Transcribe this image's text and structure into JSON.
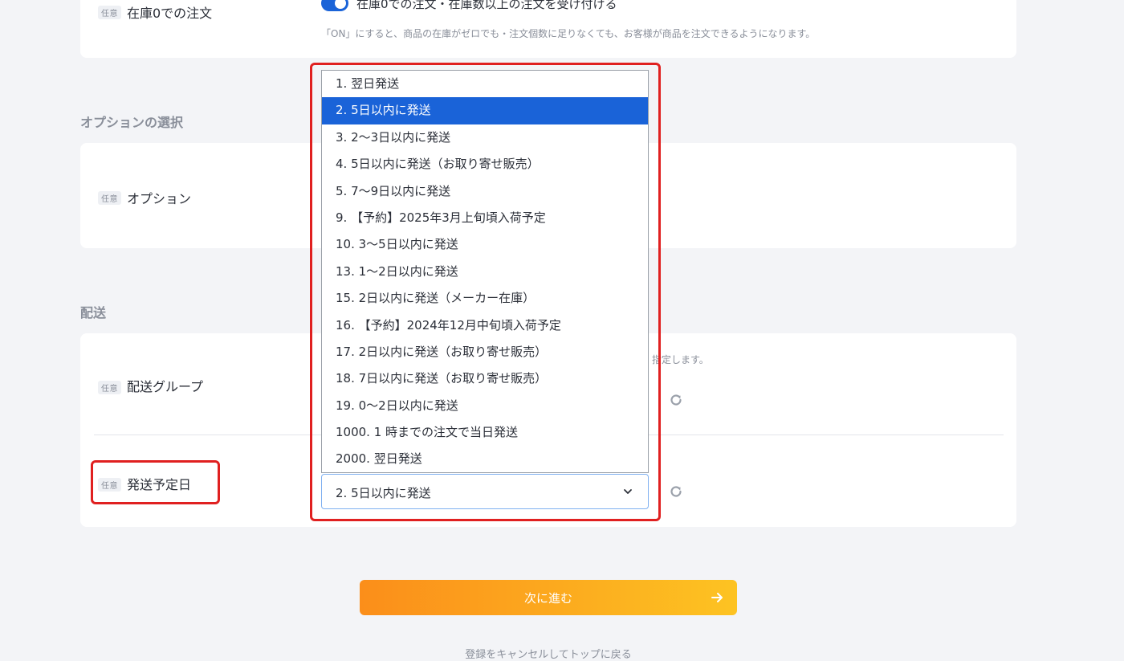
{
  "stock_zero": {
    "badge": "任意",
    "label": "在庫0での注文",
    "toggle_label": "在庫0での注文・在庫数以上の注文を受け付ける",
    "toggle_on": true,
    "helper": "「ON」にすると、商品の在庫がゼロでも・注文個数に足りなくても、お客様が商品を注文できるようになります。"
  },
  "options_section": {
    "title": "オプションの選択",
    "badge": "任意",
    "label": "オプション"
  },
  "shipping_section": {
    "title": "配送",
    "group": {
      "badge": "任意",
      "label": "配送グループ",
      "helper_fragment": "指定します。"
    },
    "ship_date": {
      "badge": "任意",
      "label": "発送予定日",
      "selected": "2. 5日以内に発送"
    }
  },
  "dropdown": {
    "items": [
      "1. 翌日発送",
      "2. 5日以内に発送",
      "3. 2〜3日以内に発送",
      "4. 5日以内に発送（お取り寄せ販売）",
      "5. 7〜9日以内に発送",
      "9. 【予約】2025年3月上旬頃入荷予定",
      "10. 3〜5日以内に発送",
      "13. 1〜2日以内に発送",
      "15. 2日以内に発送（メーカー在庫）",
      "16. 【予約】2024年12月中旬頃入荷予定",
      "17. 2日以内に発送（お取り寄せ販売）",
      "18. 7日以内に発送（お取り寄せ販売）",
      "19. 0〜2日以内に発送",
      "1000. 1 時までの注文で当日発送",
      "2000. 翌日発送"
    ],
    "selected_index": 1
  },
  "footer": {
    "next_label": "次に進む",
    "cancel_label": "登録をキャンセルしてトップに戻る"
  },
  "colors": {
    "accent": "#1a63d8",
    "highlight": "#e02020",
    "button_start": "#fb8e1a",
    "button_end": "#fdc322"
  },
  "icons": [
    "reload-icon",
    "chevron-down-icon",
    "arrow-right-icon"
  ]
}
